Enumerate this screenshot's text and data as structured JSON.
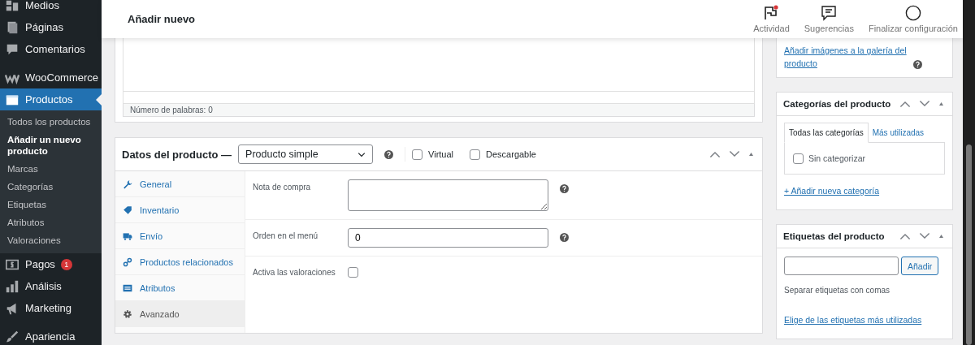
{
  "sidebar": {
    "groups": [
      [
        {
          "label": "Medios",
          "selected": false
        },
        {
          "label": "Páginas",
          "selected": false
        },
        {
          "label": "Comentarios",
          "selected": false
        }
      ],
      [
        {
          "label": "WooCommerce",
          "selected": false
        },
        {
          "label": "Productos",
          "selected": true,
          "children": [
            {
              "label": "Todos los productos",
              "selected": false
            },
            {
              "label": "Añadir un nuevo producto",
              "selected": true
            },
            {
              "label": "Marcas",
              "selected": false
            },
            {
              "label": "Categorías",
              "selected": false
            },
            {
              "label": "Etiquetas",
              "selected": false
            },
            {
              "label": "Atributos",
              "selected": false
            },
            {
              "label": "Valoraciones",
              "selected": false
            }
          ]
        },
        {
          "label": "Pagos",
          "selected": false,
          "badge": "1"
        },
        {
          "label": "Análisis",
          "selected": false
        },
        {
          "label": "Marketing",
          "selected": false
        }
      ],
      [
        {
          "label": "Apariencia",
          "selected": false
        }
      ]
    ]
  },
  "header": {
    "title": "Añadir nuevo",
    "actions": [
      {
        "label": "Actividad",
        "unread": true
      },
      {
        "label": "Sugerencias",
        "unread": false
      },
      {
        "label": "Finalizar configuración",
        "unread": false
      }
    ]
  },
  "editor": {
    "word_count": "Número de palabras: 0"
  },
  "product_data": {
    "title": "Datos del producto —",
    "type_select": "Producto simple",
    "options": [
      {
        "label": "Virtual",
        "checked": false
      },
      {
        "label": "Descargable",
        "checked": false
      }
    ],
    "tabs": [
      {
        "label": "General",
        "selected": false
      },
      {
        "label": "Inventario",
        "selected": false
      },
      {
        "label": "Envío",
        "selected": false
      },
      {
        "label": "Productos relacionados",
        "selected": false
      },
      {
        "label": "Atributos",
        "selected": false
      },
      {
        "label": "Avanzado",
        "selected": true
      }
    ],
    "fields": [
      {
        "kind": "textarea",
        "label": "Nota de compra"
      },
      {
        "kind": "input",
        "label": "Orden en el menú",
        "value": "0"
      },
      {
        "kind": "checkbox",
        "label": "Activa las valoraciones",
        "checked": false
      }
    ]
  },
  "gallery": {
    "link": "Añadir imágenes a la galería del producto"
  },
  "categories": {
    "title": "Categorías del producto",
    "tabs": [
      {
        "label": "Todas las categorías",
        "selected": true
      },
      {
        "label": "Más utilizadas",
        "selected": false
      }
    ],
    "items": [
      {
        "label": "Sin categorizar",
        "checked": false
      }
    ],
    "add_link": "+ Añadir nueva categoría"
  },
  "tags": {
    "title": "Etiquetas del producto",
    "button": "Añadir",
    "hint": "Separar etiquetas con comas",
    "link": "Elige de las etiquetas más utilizadas"
  }
}
